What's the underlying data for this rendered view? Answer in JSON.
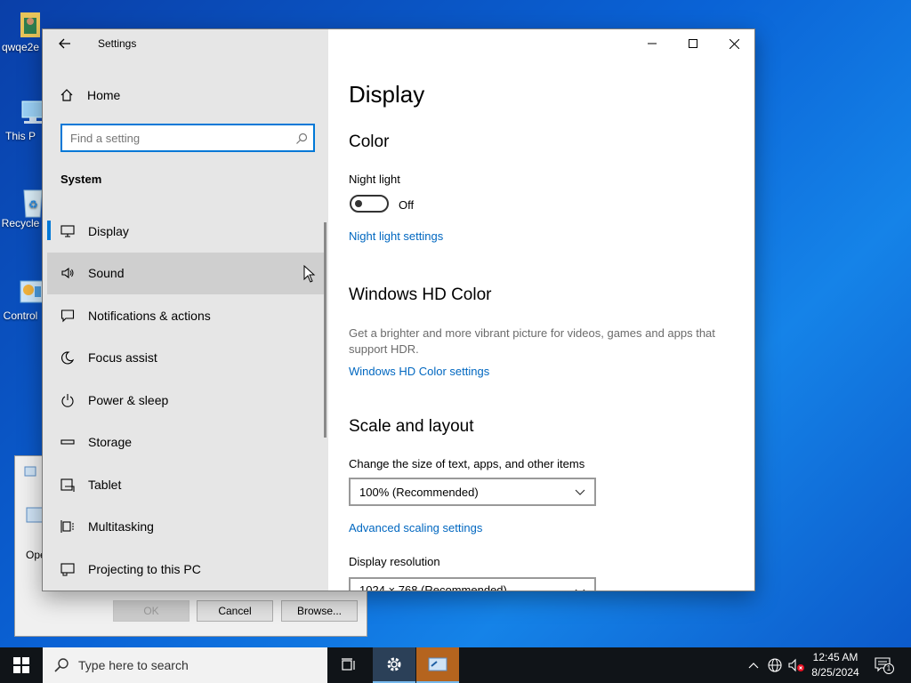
{
  "desktop": {
    "icons": [
      {
        "label": "qwqe2e",
        "icon": "user-folder-icon"
      },
      {
        "label": "This P",
        "icon": "this-pc-icon"
      },
      {
        "label": "Recycle",
        "icon": "recycle-bin-icon"
      },
      {
        "label": "Control",
        "icon": "control-panel-icon"
      }
    ]
  },
  "back_dialog": {
    "open_label": "Ope",
    "ok_label": "OK",
    "cancel_label": "Cancel",
    "browse_label": "Browse..."
  },
  "settings_window": {
    "title": "Settings",
    "home_label": "Home",
    "search_placeholder": "Find a setting",
    "section_title": "System",
    "nav_items": [
      {
        "label": "Display",
        "icon": "monitor-icon",
        "selected": true
      },
      {
        "label": "Sound",
        "icon": "speaker-icon",
        "hover": true
      },
      {
        "label": "Notifications & actions",
        "icon": "notification-icon"
      },
      {
        "label": "Focus assist",
        "icon": "moon-icon"
      },
      {
        "label": "Power & sleep",
        "icon": "power-icon"
      },
      {
        "label": "Storage",
        "icon": "storage-icon"
      },
      {
        "label": "Tablet",
        "icon": "tablet-icon"
      },
      {
        "label": "Multitasking",
        "icon": "multitasking-icon"
      },
      {
        "label": "Projecting to this PC",
        "icon": "projecting-icon"
      }
    ],
    "main": {
      "page_title": "Display",
      "color_heading": "Color",
      "night_light_label": "Night light",
      "night_light_state": "Off",
      "night_light_link": "Night light settings",
      "hd_color_heading": "Windows HD Color",
      "hd_color_desc": "Get a brighter and more vibrant picture for videos, games and apps that support HDR.",
      "hd_color_link": "Windows HD Color settings",
      "scale_heading": "Scale and layout",
      "scale_label": "Change the size of text, apps, and other items",
      "scale_value": "100% (Recommended)",
      "advanced_scaling_link": "Advanced scaling settings",
      "resolution_label": "Display resolution",
      "resolution_value": "1024 × 768 (Recommended)"
    }
  },
  "taskbar": {
    "search_placeholder": "Type here to search",
    "time": "12:45 AM",
    "date": "8/25/2024",
    "notification_count": "1"
  },
  "colors": {
    "accent": "#0078d7",
    "link": "#0067c0",
    "sidebar_bg": "#e6e6e6",
    "taskbar_bg": "#101418"
  }
}
